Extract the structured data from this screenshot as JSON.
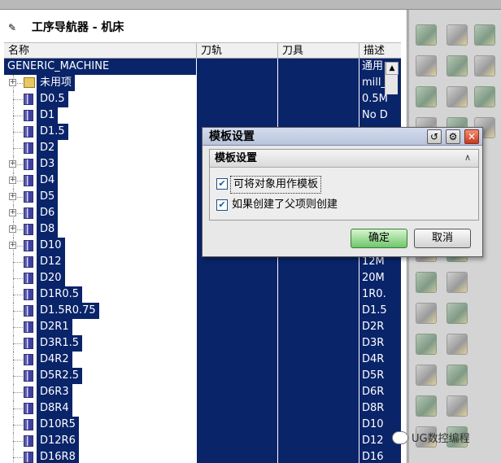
{
  "navigator": {
    "title": "工序导航器 - 机床",
    "columns": [
      "名称",
      "刀轨",
      "刀具",
      "描述"
    ]
  },
  "tree": [
    {
      "name": "GENERIC_MACHINE",
      "desc": "通用",
      "level": 0
    },
    {
      "name": "未用项",
      "desc": "mill_",
      "level": 1,
      "expandable": true,
      "icon": "folder"
    },
    {
      "name": "D0.5",
      "desc": "0.5M",
      "level": 1,
      "icon": "tool"
    },
    {
      "name": "D1",
      "desc": "No D",
      "level": 1,
      "icon": "tool"
    },
    {
      "name": "D1.5",
      "desc": "",
      "level": 1,
      "icon": "tool"
    },
    {
      "name": "D2",
      "desc": "",
      "level": 1,
      "icon": "tool"
    },
    {
      "name": "D3",
      "desc": "",
      "level": 1,
      "expandable": true,
      "icon": "tool"
    },
    {
      "name": "D4",
      "desc": "",
      "level": 1,
      "expandable": true,
      "icon": "tool"
    },
    {
      "name": "D5",
      "desc": "",
      "level": 1,
      "expandable": true,
      "icon": "tool"
    },
    {
      "name": "D6",
      "desc": "",
      "level": 1,
      "expandable": true,
      "icon": "tool"
    },
    {
      "name": "D8",
      "desc": "",
      "level": 1,
      "expandable": true,
      "icon": "tool"
    },
    {
      "name": "D10",
      "desc": "",
      "level": 1,
      "expandable": true,
      "icon": "tool"
    },
    {
      "name": "D12",
      "desc": "12M",
      "level": 1,
      "icon": "tool"
    },
    {
      "name": "D20",
      "desc": "20M",
      "level": 1,
      "icon": "tool"
    },
    {
      "name": "D1R0.5",
      "desc": "1R0.",
      "level": 1,
      "icon": "tool"
    },
    {
      "name": "D1.5R0.75",
      "desc": "D1.5",
      "level": 1,
      "icon": "tool"
    },
    {
      "name": "D2R1",
      "desc": "D2R",
      "level": 1,
      "icon": "tool"
    },
    {
      "name": "D3R1.5",
      "desc": "D3R",
      "level": 1,
      "icon": "tool"
    },
    {
      "name": "D4R2",
      "desc": "D4R",
      "level": 1,
      "icon": "tool"
    },
    {
      "name": "D5R2.5",
      "desc": "D5R",
      "level": 1,
      "icon": "tool"
    },
    {
      "name": "D6R3",
      "desc": "D6R",
      "level": 1,
      "icon": "tool"
    },
    {
      "name": "D8R4",
      "desc": "D8R",
      "level": 1,
      "icon": "tool"
    },
    {
      "name": "D10R5",
      "desc": "D10",
      "level": 1,
      "icon": "tool"
    },
    {
      "name": "D12R6",
      "desc": "D12",
      "level": 1,
      "icon": "tool"
    },
    {
      "name": "D16R8",
      "desc": "D16",
      "level": 1,
      "icon": "tool"
    }
  ],
  "dialog": {
    "title": "模板设置",
    "group_title": "模板设置",
    "checkbox1_label": "可将对象用作模板",
    "checkbox1_checked": true,
    "checkbox2_label": "如果创建了父项则创建",
    "checkbox2_checked": true,
    "ok_label": "确定",
    "cancel_label": "取消",
    "reset_icon": "↺",
    "settings_icon": "⚙",
    "close_icon": "✕",
    "collapse_icon": "∧"
  },
  "watermark": {
    "text": "UG数控编程"
  },
  "colors": {
    "selection": "#0a246a",
    "ok_button": "#6fc66a",
    "close_button": "#c83a20"
  }
}
